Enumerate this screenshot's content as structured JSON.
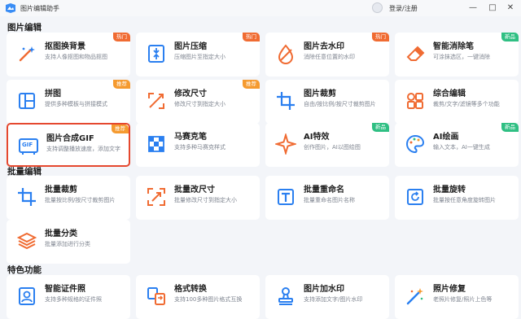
{
  "app": {
    "title": "图片编辑助手",
    "login_label": "登录/注册"
  },
  "window": {
    "minimize_glyph": "—",
    "maximize_glyph": "□",
    "close_glyph": "✕"
  },
  "sections": {
    "image_edit": "图片编辑",
    "batch_edit": "批量编辑",
    "special": "特色功能"
  },
  "colors": {
    "accent_blue": "#2a7ff0",
    "hot_badge": "#f06b32",
    "recommend_badge": "#f59a2f",
    "new_badge": "#2fbf83",
    "selected_border": "#e5482f"
  },
  "image_edit": [
    {
      "title": "抠图换背景",
      "desc": "支持人像抠图和物品抠图",
      "badge": "热门",
      "icon": "cutout-icon"
    },
    {
      "title": "图片压缩",
      "desc": "压缩图片至指定大小",
      "badge": "热门",
      "icon": "compress-icon"
    },
    {
      "title": "图片去水印",
      "desc": "消除任意位置的水印",
      "badge": "热门",
      "icon": "watermark-remove-icon"
    },
    {
      "title": "智能消除笔",
      "desc": "可涂抹选区，一键消除",
      "badge": "新品",
      "icon": "eraser-icon"
    },
    {
      "title": "拼图",
      "desc": "提供多种模板与拼接模式",
      "badge": "推荐",
      "icon": "collage-icon"
    },
    {
      "title": "修改尺寸",
      "desc": "修改尺寸到指定大小",
      "badge": "推荐",
      "icon": "resize-icon"
    },
    {
      "title": "图片裁剪",
      "desc": "自由/按比例/按尺寸裁剪图片",
      "badge": "",
      "icon": "crop-icon"
    },
    {
      "title": "综合编辑",
      "desc": "裁剪/文字/滤镜等多个功能",
      "badge": "",
      "icon": "multi-edit-icon"
    },
    {
      "title": "图片合成GIF",
      "desc": "支持调整播放速度，添加文字",
      "badge": "推荐",
      "icon": "gif-icon"
    },
    {
      "title": "马赛克笔",
      "desc": "支持多种马赛克样式",
      "badge": "",
      "icon": "mosaic-icon"
    },
    {
      "title": "AI特效",
      "desc": "创作图片，AI以图绘图",
      "badge": "新品",
      "icon": "ai-effect-icon"
    },
    {
      "title": "AI绘画",
      "desc": "输入文本，AI一键生成",
      "badge": "新品",
      "icon": "ai-paint-icon"
    }
  ],
  "batch_edit": [
    {
      "title": "批量裁剪",
      "desc": "批量按比例/按尺寸裁剪图片",
      "badge": "",
      "icon": "batch-crop-icon"
    },
    {
      "title": "批量改尺寸",
      "desc": "批量修改尺寸到指定大小",
      "badge": "",
      "icon": "batch-resize-icon"
    },
    {
      "title": "批量重命名",
      "desc": "批量重命名图片名称",
      "badge": "",
      "icon": "batch-rename-icon"
    },
    {
      "title": "批量旋转",
      "desc": "批量按任意角度旋转图片",
      "badge": "",
      "icon": "batch-rotate-icon"
    },
    {
      "title": "批量分类",
      "desc": "批量添加进行分类",
      "badge": "",
      "icon": "batch-classify-icon"
    }
  ],
  "special": [
    {
      "title": "智能证件照",
      "desc": "支持多种规格的证件照",
      "badge": "",
      "icon": "id-photo-icon"
    },
    {
      "title": "格式转换",
      "desc": "支持100多种图片格式互换",
      "badge": "",
      "icon": "format-convert-icon"
    },
    {
      "title": "图片加水印",
      "desc": "支持添加文字/图片水印",
      "badge": "",
      "icon": "add-watermark-icon"
    },
    {
      "title": "照片修复",
      "desc": "老照片修复/照片上色等",
      "badge": "",
      "icon": "photo-repair-icon"
    }
  ]
}
